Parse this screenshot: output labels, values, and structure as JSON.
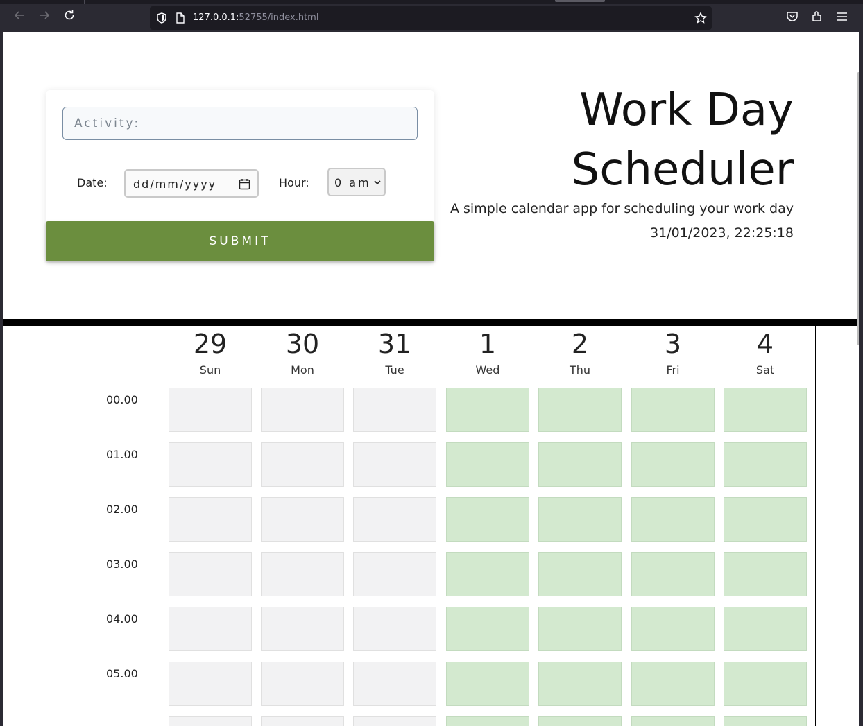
{
  "browser": {
    "url_host": "127.0.0.1:",
    "url_rest": "52755/index.html",
    "back_icon": "arrow-left-icon",
    "forward_icon": "arrow-right-icon",
    "reload_icon": "reload-icon"
  },
  "form": {
    "activity_placeholder": "Activity:",
    "date_label": "Date:",
    "date_placeholder": "dd/mm/yyyy",
    "hour_label": "Hour:",
    "hour_value": "0 am",
    "submit_label": "SUBMIT"
  },
  "header": {
    "title_line1": "Work Day",
    "title_line2": "Scheduler",
    "subtitle": "A simple calendar app for scheduling your work day",
    "clock": "31/01/2023, 22:25:18"
  },
  "calendar": {
    "days": [
      {
        "num": "29",
        "name": "Sun",
        "state": "past"
      },
      {
        "num": "30",
        "name": "Mon",
        "state": "past"
      },
      {
        "num": "31",
        "name": "Tue",
        "state": "past"
      },
      {
        "num": "1",
        "name": "Wed",
        "state": "future"
      },
      {
        "num": "2",
        "name": "Thu",
        "state": "future"
      },
      {
        "num": "3",
        "name": "Fri",
        "state": "future"
      },
      {
        "num": "4",
        "name": "Sat",
        "state": "future"
      }
    ],
    "hours": [
      "00.00",
      "01.00",
      "02.00",
      "03.00",
      "04.00",
      "05.00"
    ],
    "colors": {
      "past": "#f2f2f3",
      "future": "#d3e9cf"
    }
  }
}
